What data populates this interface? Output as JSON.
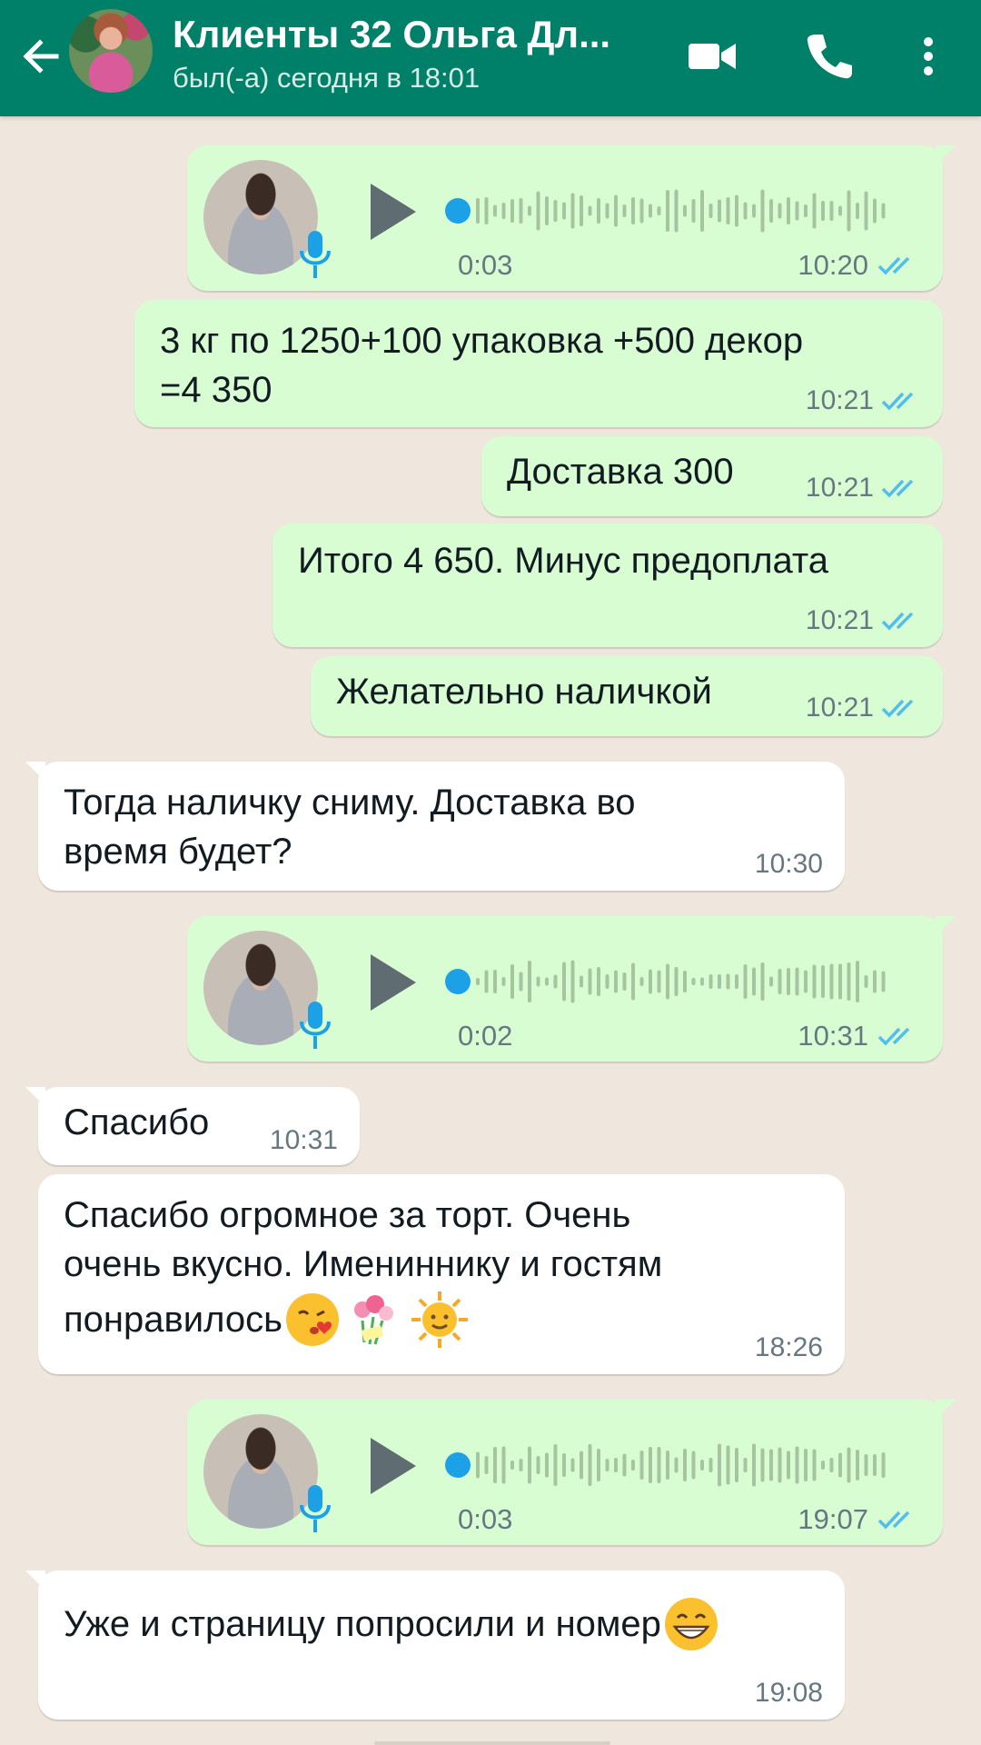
{
  "header": {
    "name": "Клиенты 32 Ольга Дл...",
    "status": "был(-а) сегодня в 18:01"
  },
  "colors": {
    "header_bg": "#008069",
    "outgoing_bubble": "#d9fdd3",
    "incoming_bubble": "#ffffff",
    "read_ticks": "#53bdeb",
    "chat_bg": "#efe7de"
  },
  "icons": [
    "back-arrow-icon",
    "video-call-icon",
    "phone-icon",
    "more-vert-icon",
    "play-icon",
    "mic-icon",
    "double-check-icon"
  ],
  "messages": [
    {
      "type": "voice",
      "dir": "out",
      "duration": "0:03",
      "time": "10:20",
      "progress": 0
    },
    {
      "type": "text",
      "dir": "out",
      "line1": "3 кг по 1250+100 упаковка +500 декор",
      "line2": "=4 350",
      "time": "10:21"
    },
    {
      "type": "text",
      "dir": "out",
      "line1": "Доставка 300",
      "time": "10:21"
    },
    {
      "type": "text",
      "dir": "out",
      "line1": "Итого 4 650. Минус предоплата",
      "time": "10:21"
    },
    {
      "type": "text",
      "dir": "out",
      "line1": "Желательно наличкой",
      "time": "10:21"
    },
    {
      "type": "text",
      "dir": "in",
      "line1": "Тогда наличку сниму. Доставка во",
      "line2": "время будет?",
      "time": "10:30"
    },
    {
      "type": "voice",
      "dir": "out",
      "duration": "0:02",
      "time": "10:31",
      "progress": 0
    },
    {
      "type": "text",
      "dir": "in",
      "line1": "Спасибо",
      "time": "10:31"
    },
    {
      "type": "text",
      "dir": "in",
      "line1": "Спасибо огромное за торт. Очень",
      "line2": "очень вкусно. Имениннику и гостям",
      "line3": "понравилось",
      "emojis": [
        "kiss-emoji",
        "flowers-emoji",
        "sun-emoji"
      ],
      "time": "18:26"
    },
    {
      "type": "voice",
      "dir": "out",
      "duration": "0:03",
      "time": "19:07",
      "progress": 0
    },
    {
      "type": "text",
      "dir": "in",
      "line1": "Уже и страницу попросили и номер",
      "emojis": [
        "grin-emoji"
      ],
      "time": "19:08"
    }
  ]
}
